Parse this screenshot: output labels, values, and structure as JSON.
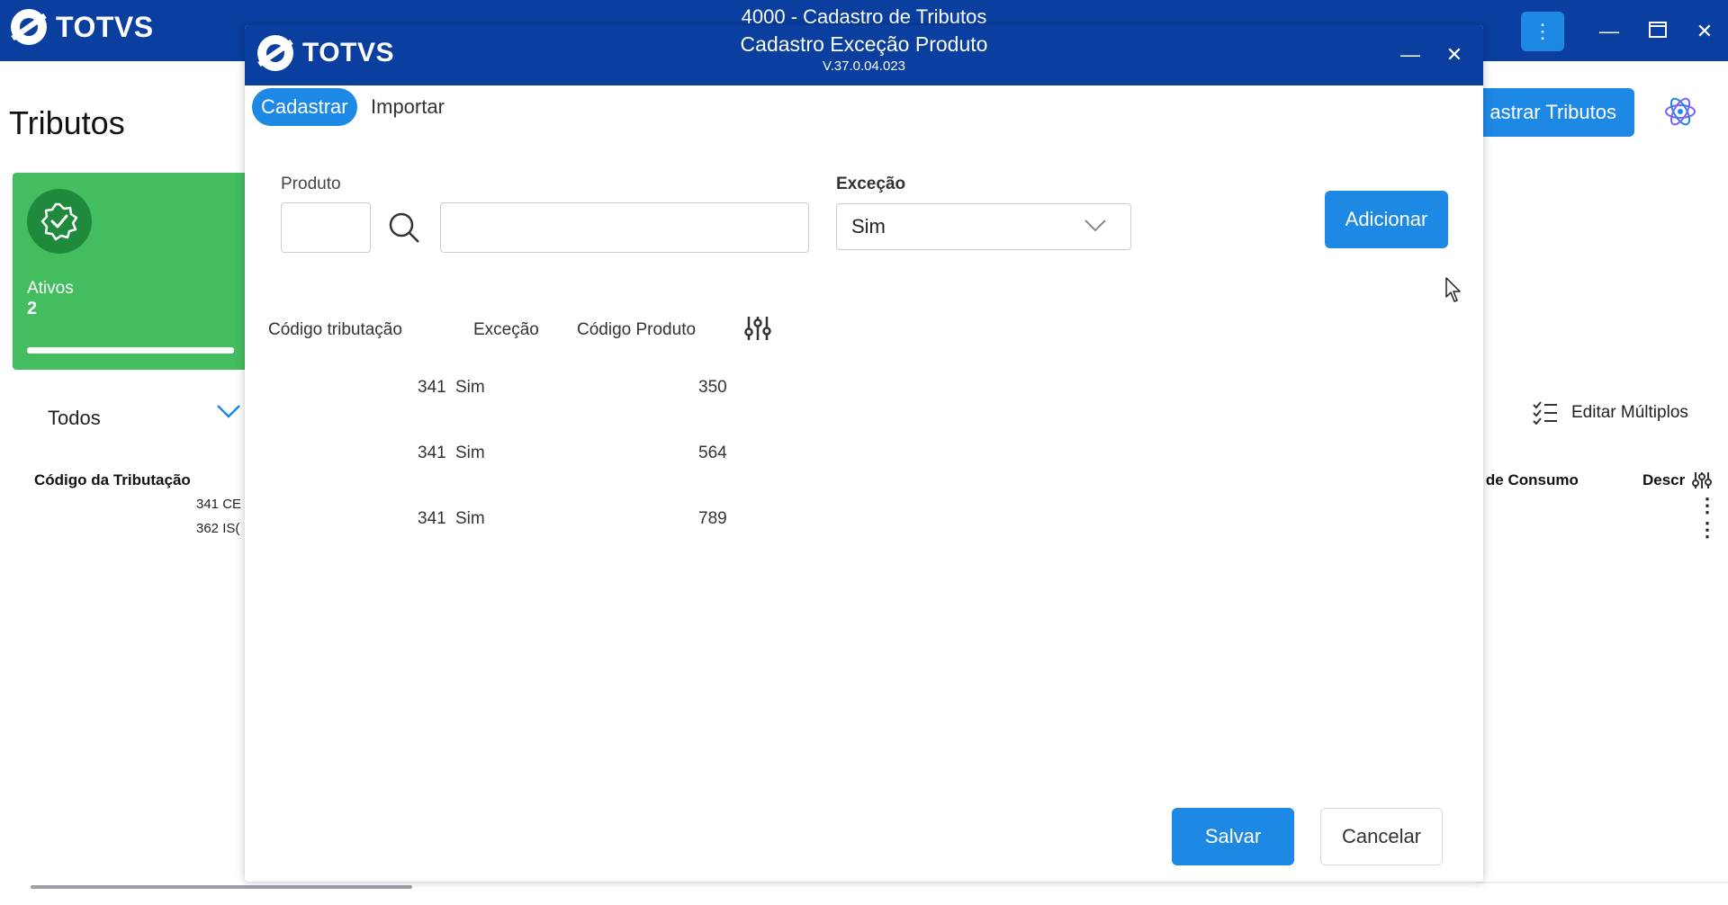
{
  "outer_window": {
    "title": "4000 - Cadastro de Tributos",
    "brand": "TOTVS",
    "kebab_glyph": "⋮",
    "minimize_glyph": "—",
    "maximize_glyph": "▭",
    "close_glyph": "✕"
  },
  "background": {
    "page_title": "Tributos",
    "summary": {
      "label": "Ativos",
      "count": "2",
      "progress": 0.8
    },
    "filter_value": "Todos",
    "top_button": "astrar Tributos",
    "edit_multiple": "Editar Múltiplos",
    "columns": {
      "codigo": "Código da Tributação",
      "consumo": "al de Consumo",
      "desc": "Descr"
    },
    "rows": [
      "341 CE",
      "362 IS("
    ]
  },
  "modal": {
    "brand": "TOTVS",
    "title": "Cadastro Exceção Produto",
    "version": "V.37.0.04.023",
    "minimize_glyph": "—",
    "close_glyph": "✕",
    "tabs": [
      {
        "label": "Cadastrar",
        "active": true
      },
      {
        "label": "Importar",
        "active": false
      }
    ],
    "form": {
      "produto_label": "Produto",
      "produto_code_value": "",
      "produto_desc_value": "",
      "excecao_label": "Exceção",
      "excecao_value": "Sim",
      "add_button": "Adicionar"
    },
    "table": {
      "headers": [
        "Código tributação",
        "Exceção",
        "Código Produto"
      ],
      "rows": [
        {
          "codigo": "341",
          "excecao": "Sim",
          "produto": "350"
        },
        {
          "codigo": "341",
          "excecao": "Sim",
          "produto": "564"
        },
        {
          "codigo": "341",
          "excecao": "Sim",
          "produto": "789"
        }
      ]
    },
    "footer": {
      "save": "Salvar",
      "cancel": "Cancelar"
    }
  },
  "colors": {
    "titlebar": "#0a3fa0",
    "accent": "#1e88e5",
    "success": "#44bd60"
  }
}
